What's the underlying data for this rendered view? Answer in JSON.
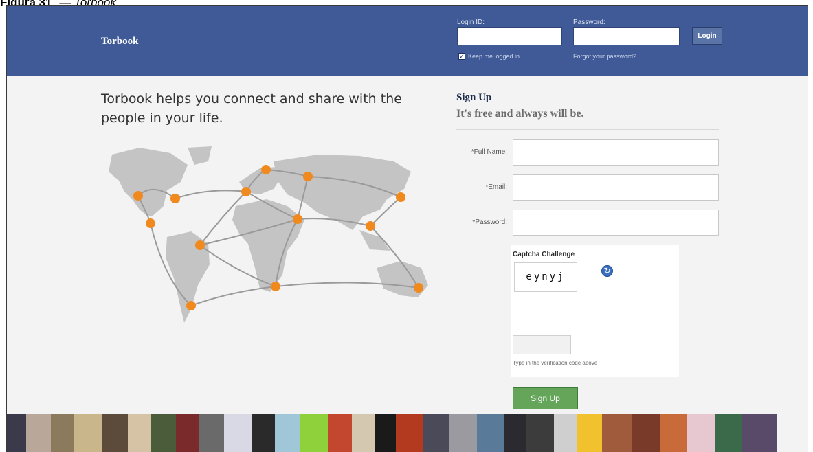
{
  "figure": {
    "number": "Figura 31",
    "title": "Torbook"
  },
  "header": {
    "brand": "Torbook",
    "login_id_label": "Login ID:",
    "password_label": "Password:",
    "login_button": "Login",
    "keep_logged_in": "Keep me logged in",
    "keep_checked": true,
    "forgot_password": "Forgot your password?"
  },
  "main": {
    "tagline": "Torbook helps you connect and share with the people in your life."
  },
  "signup": {
    "title": "Sign Up",
    "subtitle": "It's free and always will be.",
    "fields": [
      {
        "label": "*Full Name:",
        "value": ""
      },
      {
        "label": "*Email:",
        "value": ""
      },
      {
        "label": "*Password:",
        "value": ""
      }
    ],
    "captcha_title": "Captcha Challenge",
    "captcha_text": "eynyj",
    "verify_hint": "Type in the verification code above",
    "submit": "Sign Up"
  },
  "colors": {
    "header_bg": "#3f5a96",
    "map_land": "#c4c4c4",
    "map_node": "#f08a1f",
    "signup_button": "#64a55a"
  },
  "icons": {
    "refresh": "refresh-icon",
    "checkbox": "checkbox-checked-icon"
  }
}
